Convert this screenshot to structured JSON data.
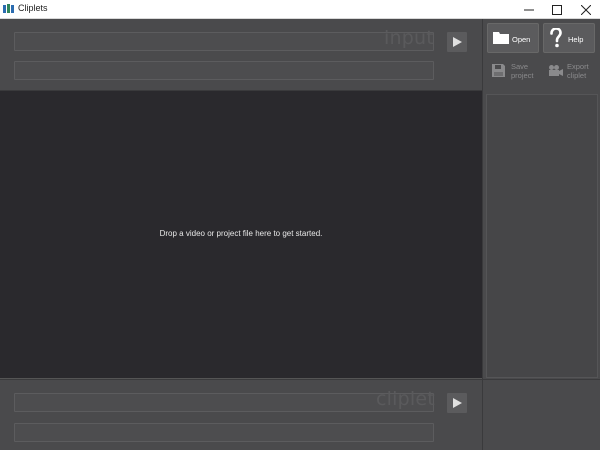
{
  "window": {
    "title": "Cliplets",
    "minimize_icon": "minimize-icon",
    "maximize_icon": "maximize-icon",
    "close_icon": "close-icon"
  },
  "input_section": {
    "label": "input",
    "play_icon": "play-icon"
  },
  "output_section": {
    "label": "cliplet",
    "play_icon": "play-icon"
  },
  "stage": {
    "message": "Drop a video or project file here to get started."
  },
  "toolbar": {
    "open": {
      "label": "Open",
      "icon": "folder-icon",
      "enabled": true
    },
    "help": {
      "label": "Help",
      "icon": "question-icon",
      "enabled": true
    },
    "save": {
      "label_line1": "Save",
      "label_line2": "project",
      "icon": "floppy-icon",
      "enabled": false
    },
    "export": {
      "label_line1": "Export",
      "label_line2": "cliplet",
      "icon": "camera-icon",
      "enabled": false
    }
  },
  "colors": {
    "panel": "#4a4a4c",
    "stage": "#2a292d",
    "button": "#5b5b5d",
    "disabled_text": "#8a8a8c"
  }
}
